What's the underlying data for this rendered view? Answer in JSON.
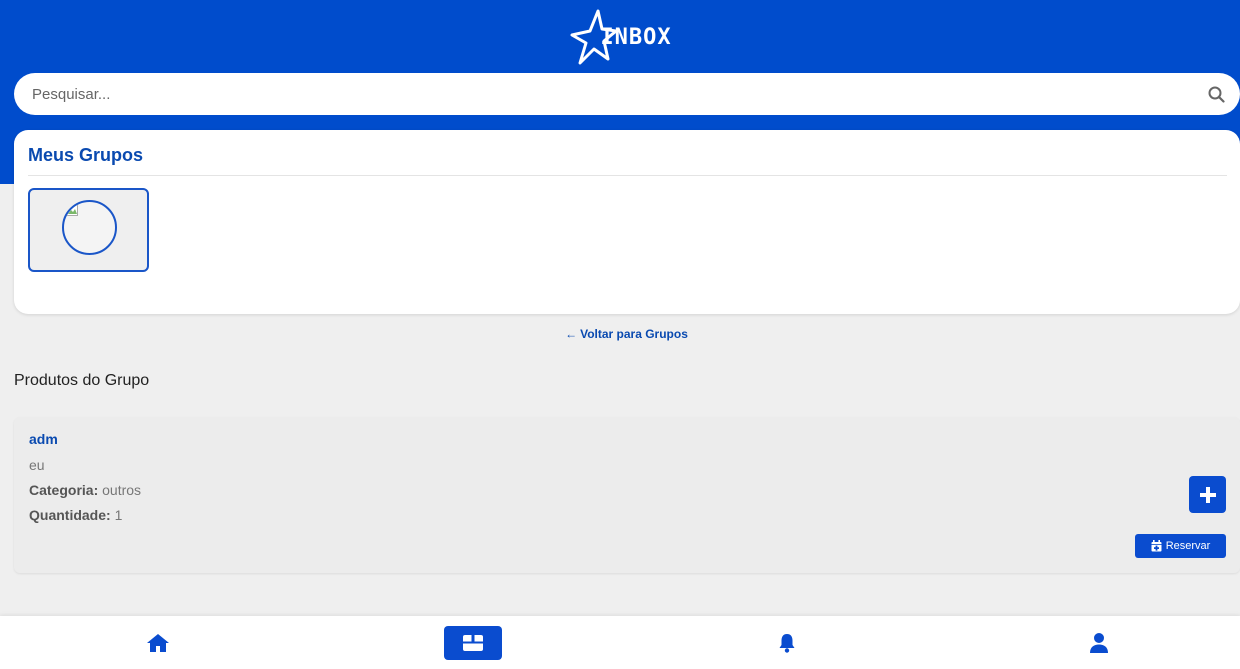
{
  "app": {
    "logo_text": "INBOX"
  },
  "search": {
    "placeholder": "Pesquisar..."
  },
  "groups": {
    "title": "Meus Grupos"
  },
  "back_link": {
    "arrow": "←",
    "label": "Voltar para Grupos"
  },
  "products_section": {
    "title": "Produtos do Grupo"
  },
  "product": {
    "name": "adm",
    "description": "eu",
    "category_label": "Categoria:",
    "category_value": "outros",
    "quantity_label": "Quantidade:",
    "quantity_value": "1",
    "add_icon": "plus-icon",
    "reserve_label": "Reservar",
    "reserve_icon": "calendar-icon"
  },
  "bottom_nav": {
    "items": [
      {
        "icon": "home-icon",
        "active": false
      },
      {
        "icon": "box-icon",
        "active": true
      },
      {
        "icon": "bell-icon",
        "active": false
      },
      {
        "icon": "user-icon",
        "active": false
      }
    ]
  },
  "colors": {
    "header_blue": "#004ccc",
    "accent_blue": "#0a4ccf",
    "title_blue": "#0a4ab0",
    "background": "#efefef"
  }
}
